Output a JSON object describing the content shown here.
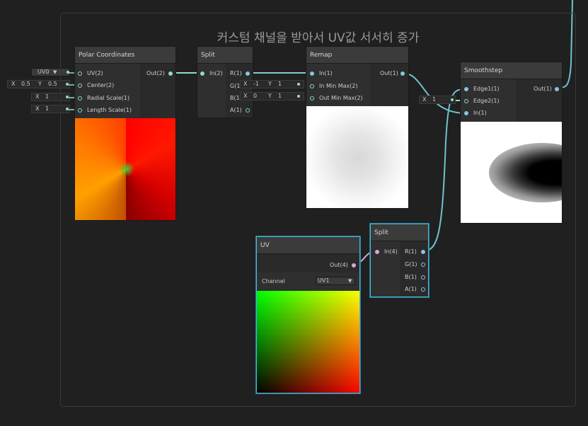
{
  "group": {
    "title": "커스텀 채널을 받아서 UV값 서서히 증가"
  },
  "polar": {
    "title": "Polar Coordinates",
    "inputs": [
      "UV(2)",
      "Center(2)",
      "Radial Scale(1)",
      "Length Scale(1)"
    ],
    "output": "Out(2)",
    "uv_dropdown": "UV0",
    "center_x_label": "X",
    "center_x": "0.5",
    "center_y_label": "Y",
    "center_y": "0.5",
    "radial_x_label": "X",
    "radial": "1",
    "length_x_label": "X",
    "length": "1"
  },
  "split1": {
    "title": "Split",
    "input": "In(2)",
    "outputs": [
      "R(1)",
      "G(1",
      "B(1",
      "A(1)"
    ]
  },
  "remap": {
    "title": "Remap",
    "inputs": [
      "In(1)",
      "In Min Max(2)",
      "Out Min Max(2)"
    ],
    "output": "Out(1)",
    "inmin_x_label": "X",
    "inmin_x": "-1",
    "inmin_y_label": "Y",
    "inmin_y": "1",
    "outmin_x_label": "X",
    "outmin_x": "0",
    "outmin_y_label": "Y",
    "outmin_y": "1"
  },
  "smooth": {
    "title": "Smoothstep",
    "inputs": [
      "Edge1(1)",
      "Edge2(1)",
      "In(1)"
    ],
    "output": "Out(1)",
    "edge2_x_label": "X",
    "edge2": "1"
  },
  "uv": {
    "title": "UV",
    "output": "Out(4)",
    "channel_label": "Channel",
    "channel_value": "UV1"
  },
  "split2": {
    "title": "Split",
    "input": "In(4)",
    "outputs": [
      "R(1)",
      "G(1)",
      "B(1)",
      "A(1)"
    ]
  },
  "colors": {
    "wire_green": "#8fdcc4",
    "wire_cyan": "#6fc3cf",
    "selected": "#44b6d6"
  }
}
